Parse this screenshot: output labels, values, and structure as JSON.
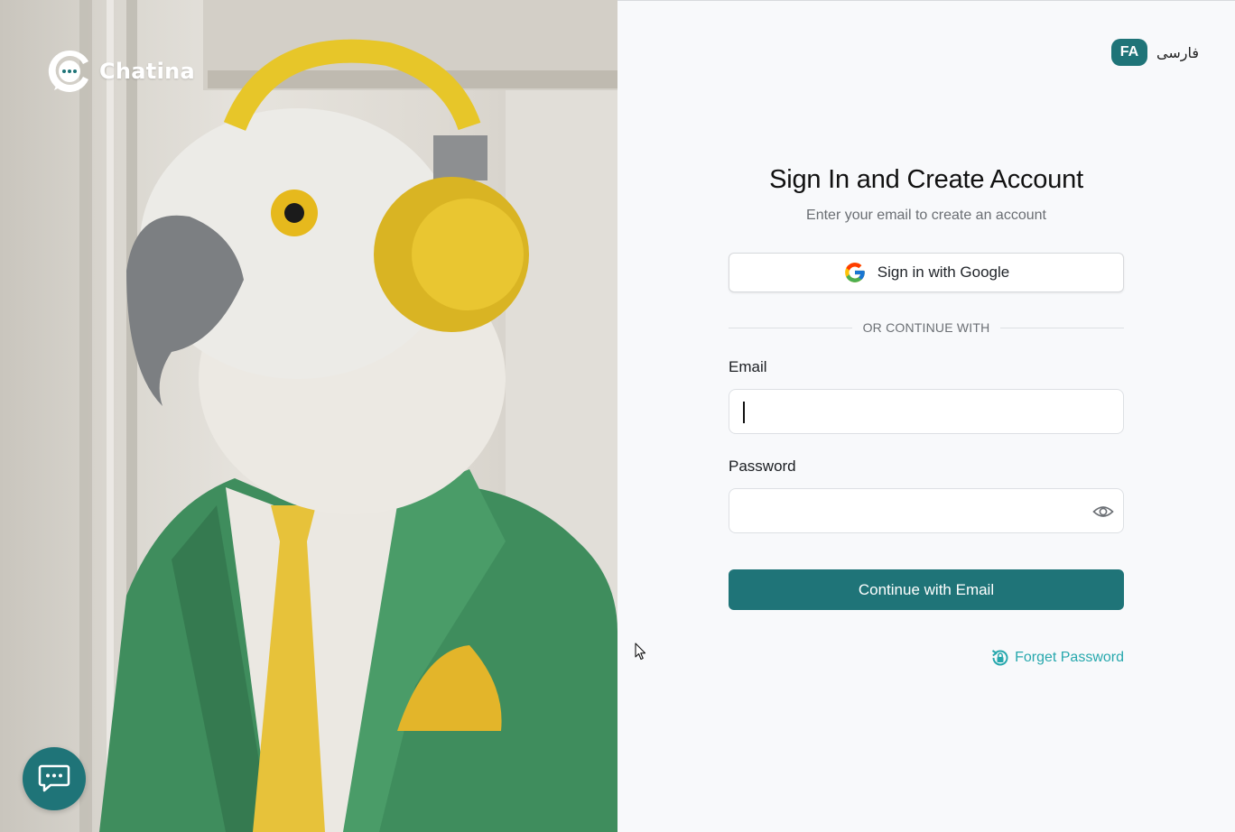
{
  "brand": {
    "name": "Chatina"
  },
  "language": {
    "badge": "FA",
    "label": "فارسی"
  },
  "form": {
    "title": "Sign In and Create Account",
    "subtitle": "Enter your email to create an account",
    "google_button": "Sign in with Google",
    "divider": "OR CONTINUE WITH",
    "email_label": "Email",
    "email_value": "",
    "password_label": "Password",
    "password_value": "",
    "submit_button": "Continue with Email",
    "forgot_link": "Forget Password"
  },
  "icons": {
    "logo": "chat-bubble-logo-icon",
    "google": "google-g-icon",
    "eye": "eye-icon",
    "forgot": "lock-reset-icon",
    "chat_fab": "chat-icon"
  },
  "colors": {
    "accent": "#1f7478",
    "link": "#27a8ad"
  }
}
